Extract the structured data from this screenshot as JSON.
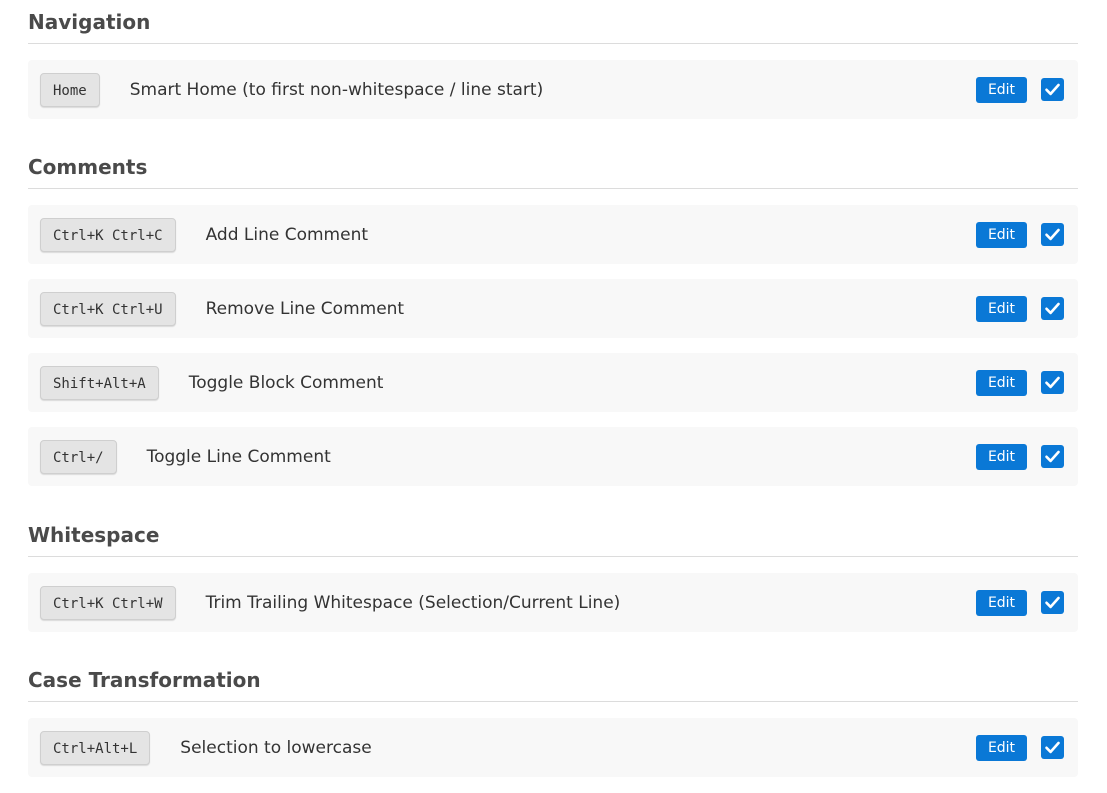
{
  "sections": [
    {
      "title": "Navigation",
      "rows": [
        {
          "key": "Home",
          "description": "Smart Home (to first non-whitespace / line start)",
          "edit_label": "Edit",
          "checked": true
        }
      ]
    },
    {
      "title": "Comments",
      "rows": [
        {
          "key": "Ctrl+K Ctrl+C",
          "description": "Add Line Comment",
          "edit_label": "Edit",
          "checked": true
        },
        {
          "key": "Ctrl+K Ctrl+U",
          "description": "Remove Line Comment",
          "edit_label": "Edit",
          "checked": true
        },
        {
          "key": "Shift+Alt+A",
          "description": "Toggle Block Comment",
          "edit_label": "Edit",
          "checked": true
        },
        {
          "key": "Ctrl+/",
          "description": "Toggle Line Comment",
          "edit_label": "Edit",
          "checked": true
        }
      ]
    },
    {
      "title": "Whitespace",
      "rows": [
        {
          "key": "Ctrl+K Ctrl+W",
          "description": "Trim Trailing Whitespace (Selection/Current Line)",
          "edit_label": "Edit",
          "checked": true
        }
      ]
    },
    {
      "title": "Case Transformation",
      "rows": [
        {
          "key": "Ctrl+Alt+L",
          "description": "Selection to lowercase",
          "edit_label": "Edit",
          "checked": true
        }
      ]
    }
  ],
  "colors": {
    "accent": "#0a78d6",
    "row_background": "#f8f8f8",
    "key_background": "#e4e4e4",
    "heading": "#4a4a4a"
  },
  "icons": {
    "checkbox": "checkmark-icon"
  }
}
